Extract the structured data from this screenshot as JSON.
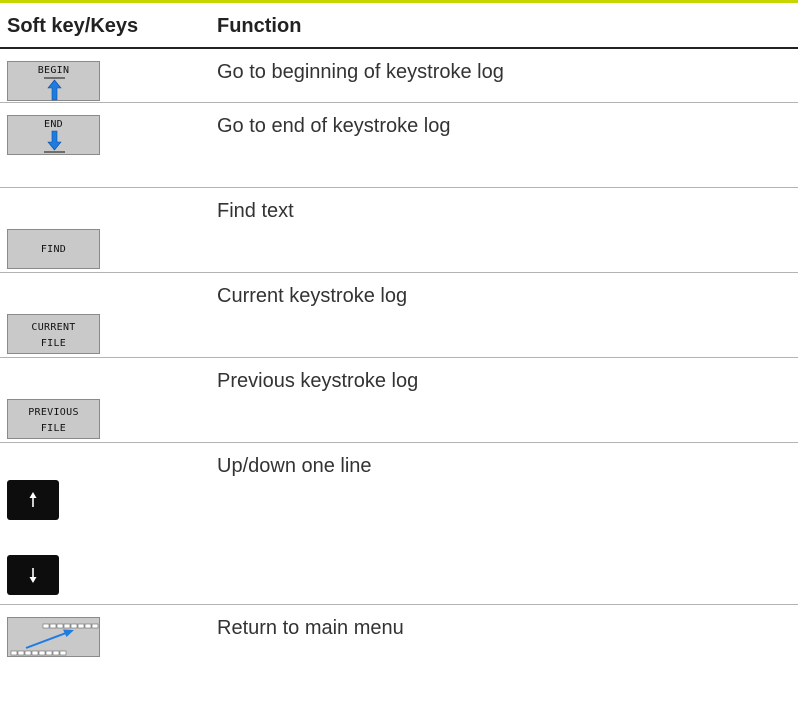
{
  "header": {
    "col_softkey": "Soft key/Keys",
    "col_function": "Function"
  },
  "rows": [
    {
      "key_label": "BEGIN",
      "icon": "arrow-up-to-line-icon",
      "function": "Go to beginning of keystroke log"
    },
    {
      "key_label": "END",
      "icon": "arrow-down-to-line-icon",
      "function": "Go to end of keystroke log"
    },
    {
      "key_label": "FIND",
      "function": "Find text"
    },
    {
      "key_label_line1": "CURRENT",
      "key_label_line2": "FILE",
      "function": "Current keystroke log"
    },
    {
      "key_label_line1": "PREVIOUS",
      "key_label_line2": "FILE",
      "function": "Previous keystroke log"
    },
    {
      "keys": [
        "arrow-up-key-icon",
        "arrow-down-key-icon"
      ],
      "function": "Up/down one line"
    },
    {
      "icon": "return-to-main-menu-icon",
      "function": "Return to main menu"
    }
  ],
  "colors": {
    "accent_rule": "#c8d600",
    "softkey_bg": "#c9c9c9",
    "arrow_blue": "#1e7be0",
    "key_bg": "#0d0d0d"
  }
}
